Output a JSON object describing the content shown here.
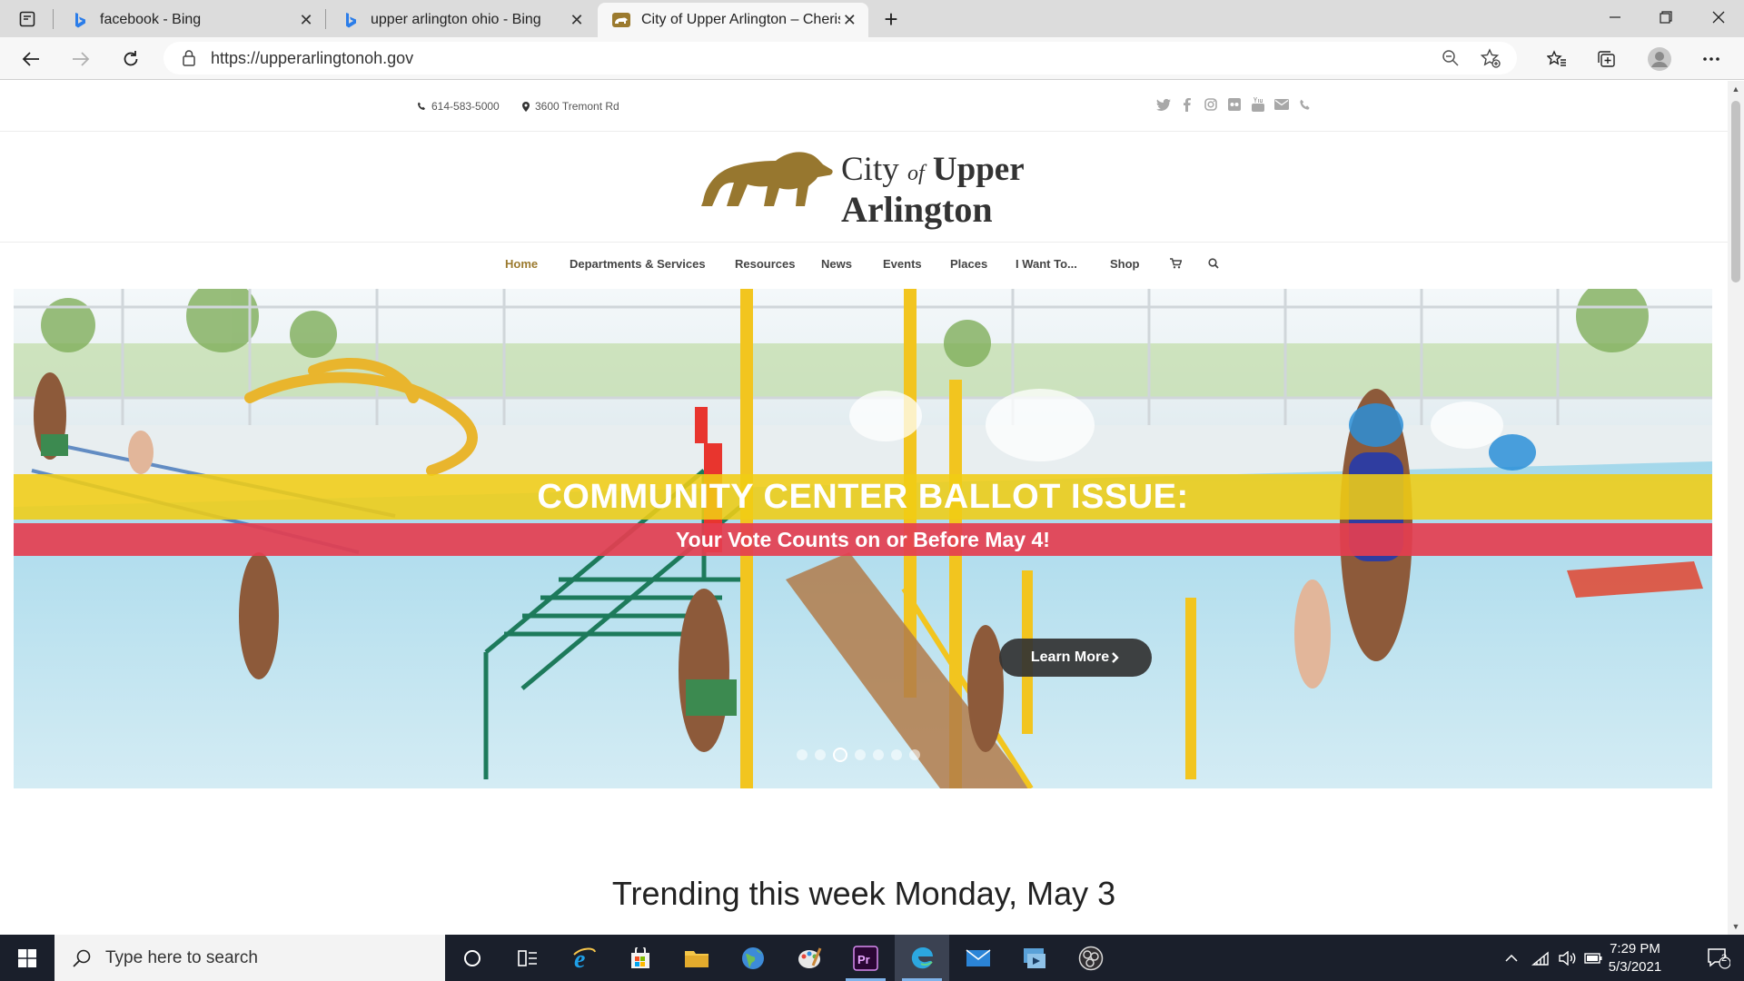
{
  "browser": {
    "tabs": [
      {
        "title": "facebook - Bing",
        "favicon": "bing-icon",
        "active": false
      },
      {
        "title": "upper arlington ohio - Bing",
        "favicon": "bing-icon",
        "active": false
      },
      {
        "title": "City of Upper Arlington – Cheris",
        "favicon": "bear-favicon-icon",
        "active": true
      }
    ],
    "url": "https://upperarlingtonoh.gov"
  },
  "site": {
    "phone": "614-583-5000",
    "address": "3600 Tremont Rd",
    "logo": {
      "line1_city": "City",
      "line1_of": "of",
      "line1_upper": "Upper",
      "line2": "Arlington"
    },
    "nav": [
      "Home",
      "Departments & Services",
      "Resources",
      "News",
      "Events",
      "Places",
      "I Want To...",
      "Shop"
    ],
    "nav_active": "Home",
    "hero": {
      "headline": "COMMUNITY CENTER BALLOT ISSUE:",
      "subheadline": "Your Vote Counts on or Before May 4!",
      "button": "Learn More"
    },
    "trending": "Trending this week Monday, May 3"
  },
  "taskbar": {
    "search_placeholder": "Type here to search",
    "time": "7:29 PM",
    "date": "5/3/2021",
    "notifications": "2"
  },
  "colors": {
    "brand_gold": "#9b7a2e",
    "banner_yellow": "#f0cd14",
    "banner_red": "#e43e50"
  }
}
